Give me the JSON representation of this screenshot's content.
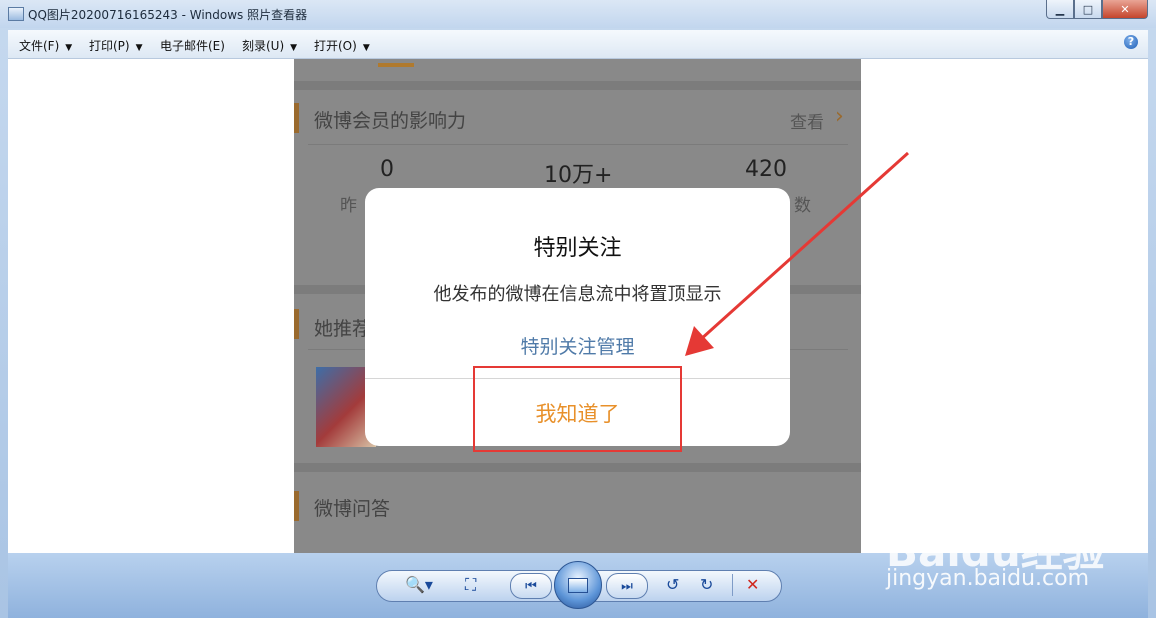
{
  "window": {
    "title": "QQ图片20200716165243 - Windows 照片查看器",
    "min": "▁",
    "max": "□",
    "close": "✕"
  },
  "menu": {
    "items": [
      {
        "label": "文件(F)",
        "caret": "▼"
      },
      {
        "label": "打印(P)",
        "caret": "▼"
      },
      {
        "label": "电子邮件(E)"
      },
      {
        "label": "刻录(U)",
        "caret": "▼"
      },
      {
        "label": "打开(O)",
        "caret": "▼"
      }
    ],
    "help": "?"
  },
  "photo": {
    "section1": {
      "title": "微博会员的影响力",
      "view": "查看",
      "chevron": "›"
    },
    "stats": [
      {
        "value": "0",
        "label": "昨"
      },
      {
        "value": "10万+",
        "label": ""
      },
      {
        "value": "420",
        "label": "数"
      }
    ],
    "section2": {
      "title": "她推荐"
    },
    "section3": {
      "title": "微博问答"
    }
  },
  "dialog": {
    "title": "特别关注",
    "message": "他发布的微博在信息流中将置顶显示",
    "link": "特别关注管理",
    "confirm": "我知道了"
  },
  "annotation": {
    "box_color": "#e53935"
  },
  "toolbar": {
    "zoom": "🔍▾",
    "actual_size": "⛶",
    "prev": "⏮",
    "next": "⏭",
    "rotate_ccw": "↺",
    "rotate_cw": "↻",
    "delete": "✕"
  },
  "watermark": {
    "logo": "Baidu经验",
    "url": "jingyan.baidu.com"
  }
}
